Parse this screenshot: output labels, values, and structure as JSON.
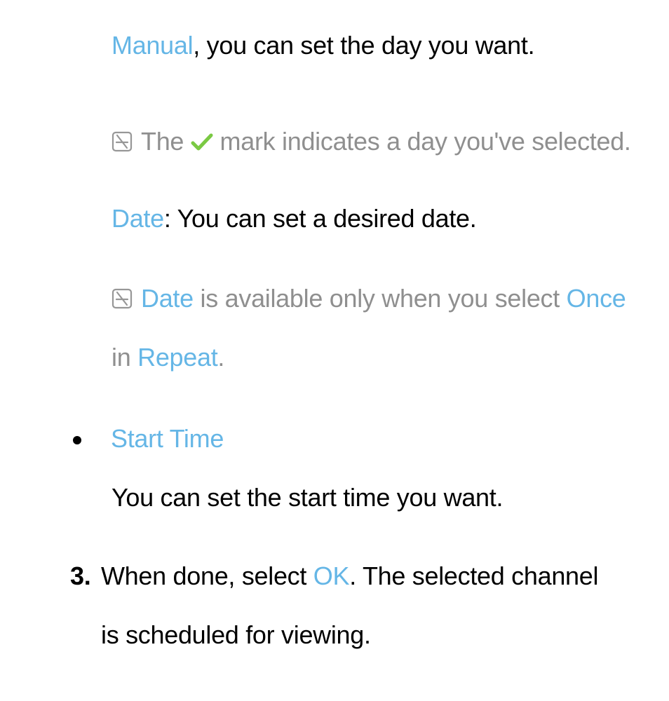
{
  "para1": {
    "manual": "Manual",
    "rest": ", you can set the day you want."
  },
  "note1": {
    "pre": "The ",
    "post": " mark indicates a day you've selected."
  },
  "dateline": {
    "label": "Date",
    "rest": ": You can set a desired date."
  },
  "note2": {
    "date": "Date",
    "mid": " is available only when you select ",
    "once": "Once",
    "in": " in ",
    "repeat": "Repeat",
    "end": "."
  },
  "startTime": {
    "title": "Start Time",
    "body": "You can set the start time you want."
  },
  "step3": {
    "num": "3.",
    "pre": "When done, select ",
    "ok": "OK",
    "post": ". The selected channel is scheduled for viewing."
  }
}
